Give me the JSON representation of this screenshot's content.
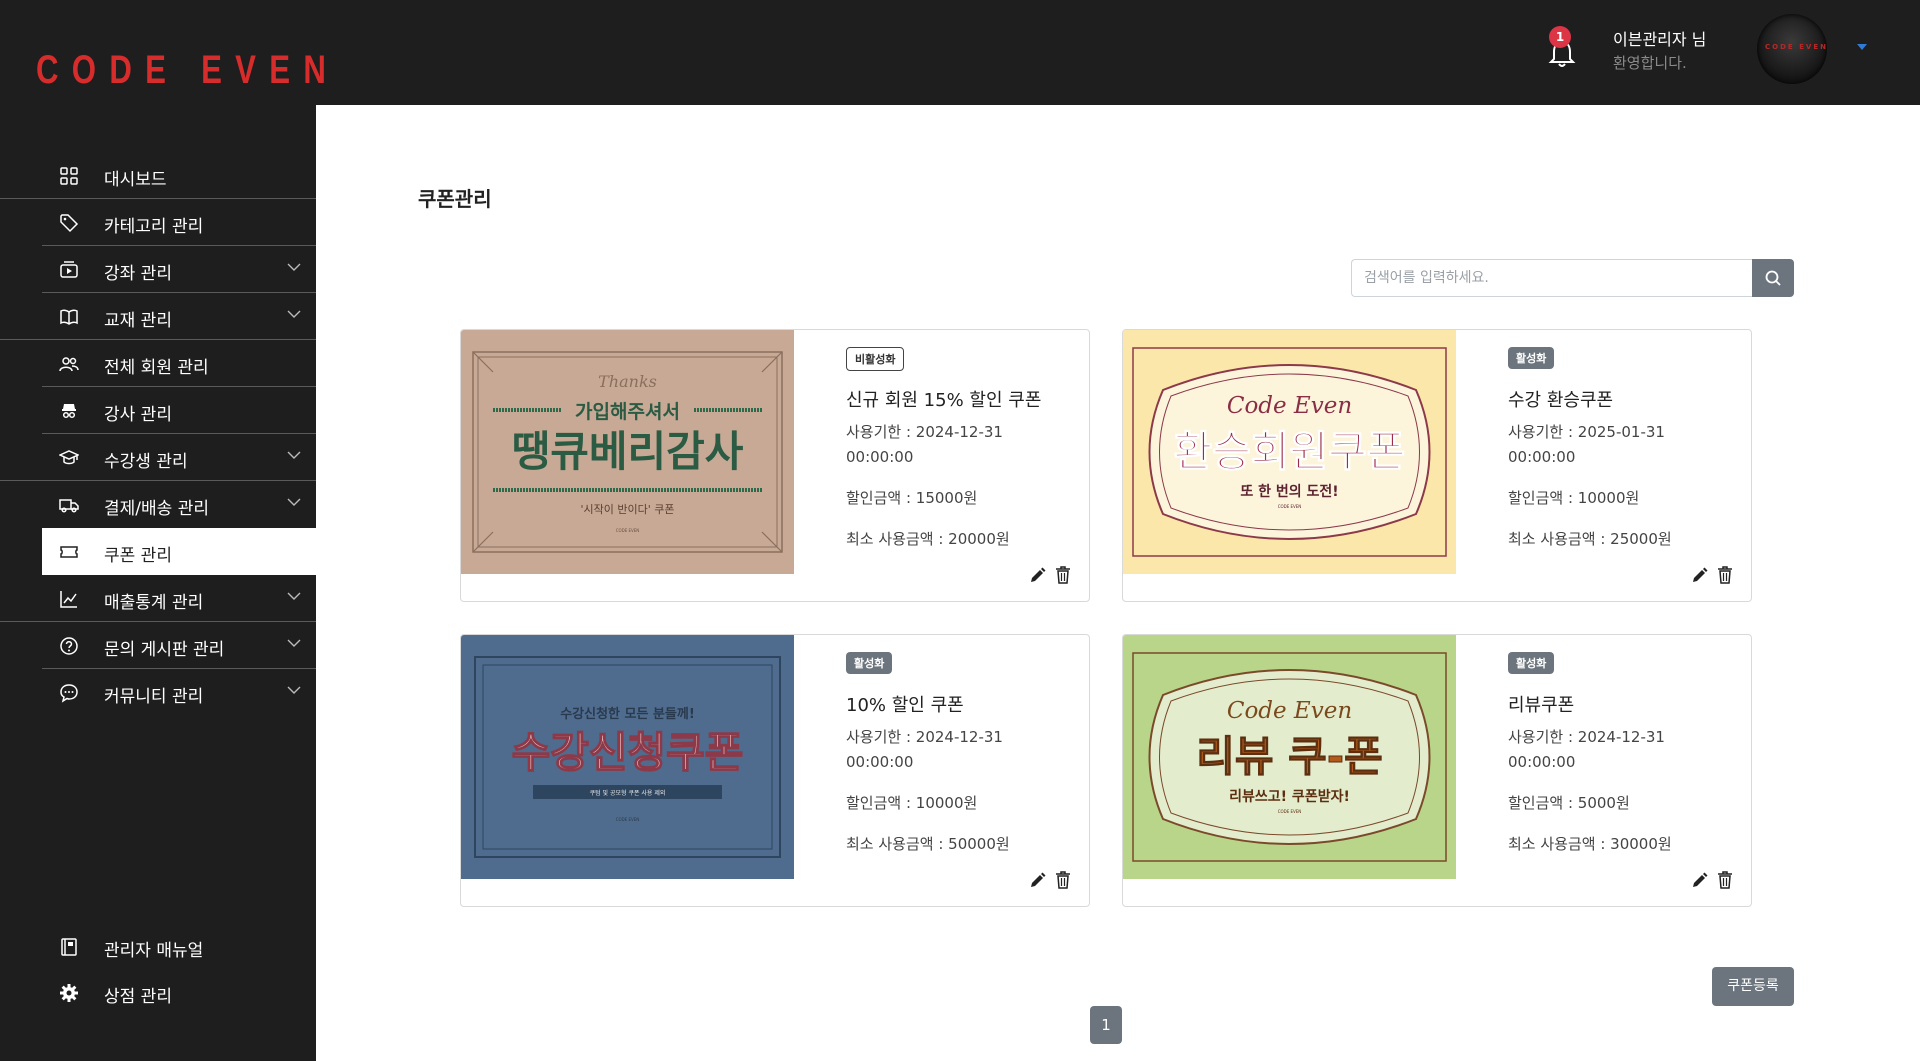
{
  "header": {
    "logo": "CODE EVEN",
    "notification_count": "1",
    "user_name": "이븐관리자 님",
    "user_greeting": "환영합니다.",
    "avatar_text": "CODE EVEN"
  },
  "sidebar": {
    "items": [
      {
        "label": "대시보드",
        "icon": "dashboard-icon"
      },
      {
        "label": "카테고리 관리",
        "icon": "tag-icon"
      },
      {
        "label": "강좌 관리",
        "icon": "video-icon"
      },
      {
        "label": "교재 관리",
        "icon": "book-icon"
      },
      {
        "label": "전체 회원 관리",
        "icon": "users-icon"
      },
      {
        "label": "강사 관리",
        "icon": "instructor-icon"
      },
      {
        "label": "수강생 관리",
        "icon": "graduation-cap-icon"
      },
      {
        "label": "결제/배송 관리",
        "icon": "truck-icon"
      },
      {
        "label": "쿠폰 관리",
        "icon": "ticket-icon"
      },
      {
        "label": "매출통계 관리",
        "icon": "chart-line-icon"
      },
      {
        "label": "문의 게시판 관리",
        "icon": "question-circle-icon"
      },
      {
        "label": "커뮤니티 관리",
        "icon": "chat-icon"
      }
    ],
    "active_item": "쿠폰 관리",
    "bottom_items": [
      {
        "label": "관리자 매뉴얼",
        "icon": "manual-icon"
      },
      {
        "label": "상점 관리",
        "icon": "gear-icon"
      }
    ]
  },
  "main": {
    "title": "쿠폰관리",
    "search": {
      "placeholder": "검색어를 입력하세요.",
      "value": ""
    },
    "coupons": [
      {
        "status": "비활성화",
        "name": "신규 회원 15% 할인 쿠폰",
        "expiry": "사용기한 : 2024-12-31 00:00:00",
        "discount": "할인금액 : 15000원",
        "min_amount": "최소 사용금액 : 20000원",
        "image": {
          "top": "Thanks",
          "sub": "가입해주셔서",
          "main": "땡큐베리감사",
          "foot": "'시작이 반이다' 쿠폰",
          "brand": "CODE EVEN"
        }
      },
      {
        "status": "활성화",
        "name": "수강 환승쿠폰",
        "expiry": "사용기한 : 2025-01-31 00:00:00",
        "discount": "할인금액 : 10000원",
        "min_amount": "최소 사용금액 : 25000원",
        "image": {
          "top": "Code Even",
          "main": "환승회원쿠폰",
          "foot": "또 한 번의 도전!",
          "brand": "CODE EVEN"
        }
      },
      {
        "status": "활성화",
        "name": "10% 할인 쿠폰",
        "expiry": "사용기한 : 2024-12-31 00:00:00",
        "discount": "할인금액 : 10000원",
        "min_amount": "최소 사용금액 : 50000원",
        "image": {
          "top": "수강신청한 모든 분들께!",
          "main": "수강신청쿠폰",
          "foot": "쿠텀 및 공모형 쿠폰 사용 제외",
          "brand": "CODE EVEN"
        }
      },
      {
        "status": "활성화",
        "name": "리뷰쿠폰",
        "expiry": "사용기한 : 2024-12-31 00:00:00",
        "discount": "할인금액 : 5000원",
        "min_amount": "최소 사용금액 : 30000원",
        "image": {
          "top": "Code Even",
          "main": "리뷰 쿠-폰",
          "foot": "리뷰쓰고! 쿠폰받자!",
          "brand": "CODE EVEN"
        }
      }
    ],
    "register_label": "쿠폰등록",
    "pagination": {
      "current": "1"
    }
  },
  "colors": {
    "brand": "#d62c2c",
    "sidebar_bg": "#1e1e1e",
    "button": "#6c757d"
  }
}
